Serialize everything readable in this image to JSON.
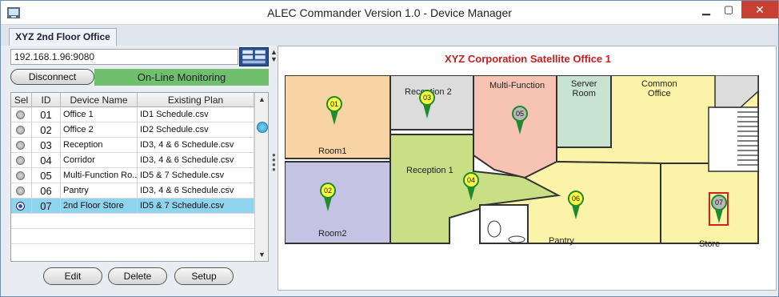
{
  "window": {
    "title": "ALEC Commander Version 1.0 - Device Manager",
    "minimize": "▁",
    "maximize": "▢",
    "close": "✕"
  },
  "tab": {
    "label": "XYZ 2nd Floor Office"
  },
  "connection": {
    "address": "192.168.1.96:9080",
    "disconnect_label": "Disconnect",
    "status": "On-Line Monitoring",
    "status_color": "#6fbf6f"
  },
  "table": {
    "headers": [
      "Sel",
      "ID",
      "Device Name",
      "Existing Plan"
    ],
    "rows": [
      {
        "id": "01",
        "name": "Office 1",
        "plan": "ID1 Schedule.csv",
        "selected": false
      },
      {
        "id": "02",
        "name": "Office 2",
        "plan": "ID2 Schedule.csv",
        "selected": false
      },
      {
        "id": "03",
        "name": "Reception",
        "plan": "ID3, 4 & 6 Schedule.csv",
        "selected": false
      },
      {
        "id": "04",
        "name": "Corridor",
        "plan": "ID3, 4 & 6 Schedule.csv",
        "selected": false
      },
      {
        "id": "05",
        "name": "Multi-Function Ro...",
        "plan": "ID5 & 7 Schedule.csv",
        "selected": false
      },
      {
        "id": "06",
        "name": "Pantry",
        "plan": "ID3, 4 & 6 Schedule.csv",
        "selected": false
      },
      {
        "id": "07",
        "name": "2nd Floor Store",
        "plan": "ID5 & 7 Schedule.csv",
        "selected": true
      }
    ]
  },
  "buttons": {
    "edit": "Edit",
    "delete": "Delete",
    "setup": "Setup"
  },
  "map": {
    "title": "XYZ Corporation Satellite Office 1",
    "rooms": {
      "room1": "Room1",
      "room2": "Room2",
      "reception2": "Reception 2",
      "reception1": "Reception 1",
      "multifunction": "Multi-Function",
      "server": "Server\nRoom",
      "common": "Common\nOffice",
      "pantry": "Pantry",
      "store": "Store"
    },
    "pins": [
      "01",
      "02",
      "03",
      "04",
      "05",
      "06",
      "07"
    ],
    "colors": {
      "room1": "#f8d3a4",
      "room2": "#c5c3e3",
      "reception": "#c8df86",
      "multifunction": "#f7c4b4",
      "server": "#c9e3d2",
      "common": "#fbf3a7",
      "grey": "#dcdcdc"
    }
  }
}
